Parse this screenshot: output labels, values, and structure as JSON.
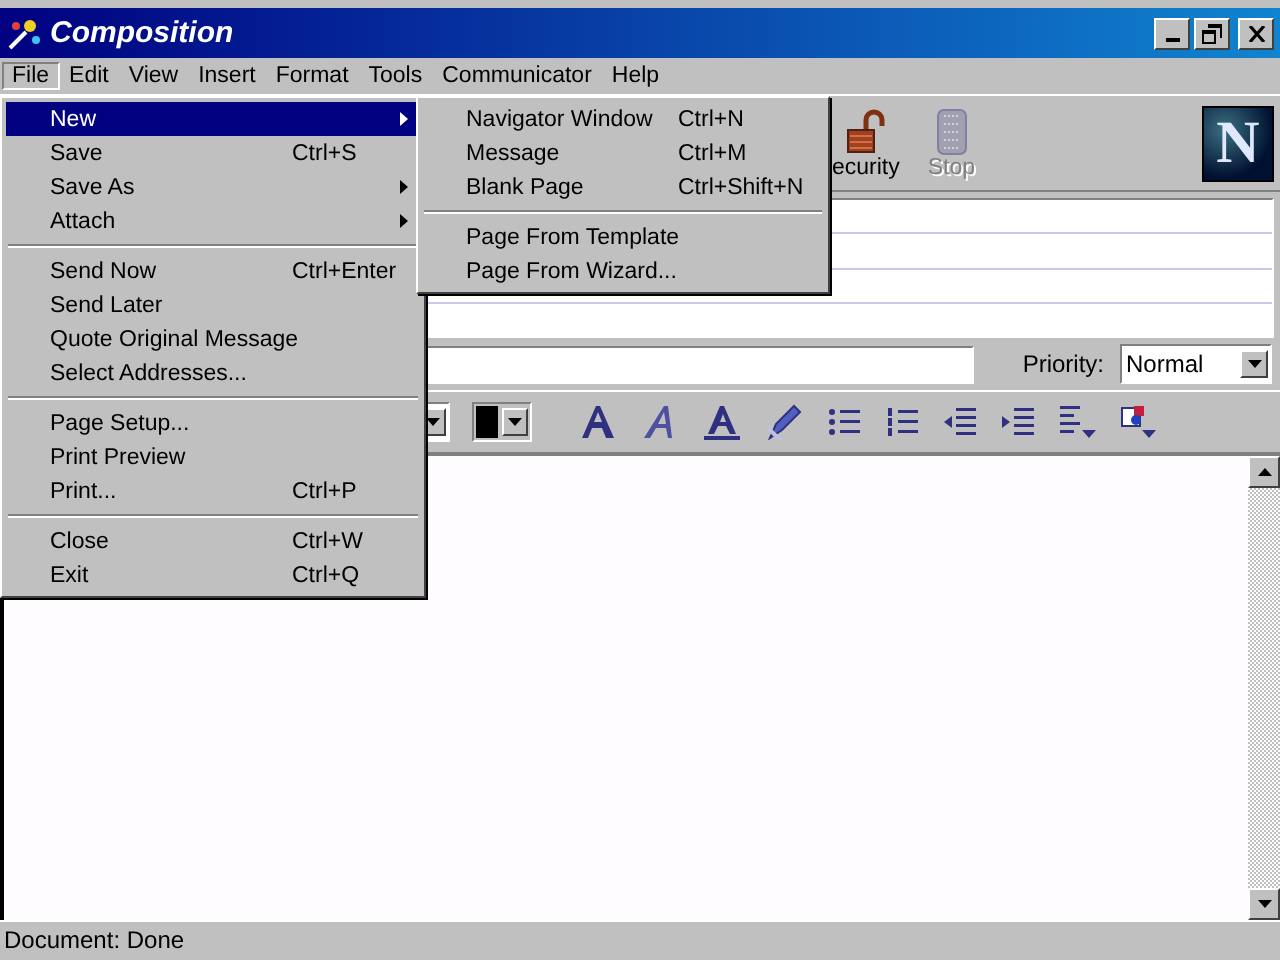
{
  "window": {
    "title": "Composition"
  },
  "menu_bar": [
    {
      "label": "File",
      "selected": true
    },
    {
      "label": "Edit",
      "selected": false
    },
    {
      "label": "View",
      "selected": false
    },
    {
      "label": "Insert",
      "selected": false
    },
    {
      "label": "Format",
      "selected": false
    },
    {
      "label": "Tools",
      "selected": false
    },
    {
      "label": "Communicator",
      "selected": false
    },
    {
      "label": "Help",
      "selected": false
    }
  ],
  "file_menu": [
    {
      "kind": "item",
      "label": "New",
      "submenu": true,
      "selected": true
    },
    {
      "kind": "item",
      "label": "Save",
      "shortcut": "Ctrl+S",
      "submenu": false,
      "selected": false
    },
    {
      "kind": "item",
      "label": "Save As",
      "submenu": true,
      "selected": false
    },
    {
      "kind": "item",
      "label": "Attach",
      "submenu": true,
      "selected": false
    },
    {
      "kind": "separator"
    },
    {
      "kind": "item",
      "label": "Send Now",
      "shortcut": "Ctrl+Enter",
      "submenu": false,
      "selected": false
    },
    {
      "kind": "item",
      "label": "Send Later",
      "submenu": false,
      "selected": false
    },
    {
      "kind": "item",
      "label": "Quote Original Message",
      "submenu": false,
      "selected": false
    },
    {
      "kind": "item",
      "label": "Select Addresses...",
      "submenu": false,
      "selected": false
    },
    {
      "kind": "separator"
    },
    {
      "kind": "item",
      "label": "Page Setup...",
      "submenu": false,
      "selected": false
    },
    {
      "kind": "item",
      "label": "Print Preview",
      "submenu": false,
      "selected": false
    },
    {
      "kind": "item",
      "label": "Print...",
      "shortcut": "Ctrl+P",
      "submenu": false,
      "selected": false
    },
    {
      "kind": "separator"
    },
    {
      "kind": "item",
      "label": "Close",
      "shortcut": "Ctrl+W",
      "submenu": false,
      "selected": false
    },
    {
      "kind": "item",
      "label": "Exit",
      "shortcut": "Ctrl+Q",
      "submenu": false,
      "selected": false
    }
  ],
  "new_submenu": [
    {
      "kind": "item",
      "label": "Navigator Window",
      "shortcut": "Ctrl+N",
      "submenu": false,
      "selected": false
    },
    {
      "kind": "item",
      "label": "Message",
      "shortcut": "Ctrl+M",
      "submenu": false,
      "selected": false
    },
    {
      "kind": "item",
      "label": "Blank Page",
      "shortcut": "Ctrl+Shift+N",
      "submenu": false,
      "selected": false
    },
    {
      "kind": "separator"
    },
    {
      "kind": "item",
      "label": "Page From Template",
      "submenu": false,
      "selected": false
    },
    {
      "kind": "item",
      "label": "Page From Wizard...",
      "submenu": false,
      "selected": false
    }
  ],
  "toolbar": {
    "buttons": [
      {
        "kind": "lock",
        "label": "ecurity",
        "disabled": false
      },
      {
        "kind": "stop",
        "label": "Stop",
        "disabled": true
      }
    ],
    "logo": "N"
  },
  "subject_row": {
    "priority_label": "Priority:",
    "priority_value": "Normal"
  },
  "status_bar": {
    "text": "Document: Done"
  }
}
